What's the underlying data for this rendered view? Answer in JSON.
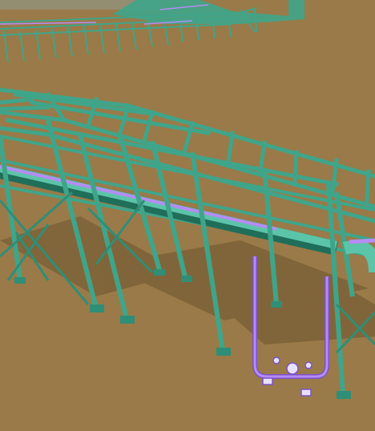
{
  "scene": {
    "colors": {
      "ground": "#9a7a48",
      "ground_far": "#8d6f3f",
      "steel": "#3fa58a",
      "steel_light": "#5cc4a8",
      "steel_dark": "#1f6e5a",
      "shadow": "#6c5530",
      "pipe_purple": "#b58cf5",
      "pipe_purple_dark": "#7c52c9",
      "sky_band": "#8f9a8f"
    }
  }
}
